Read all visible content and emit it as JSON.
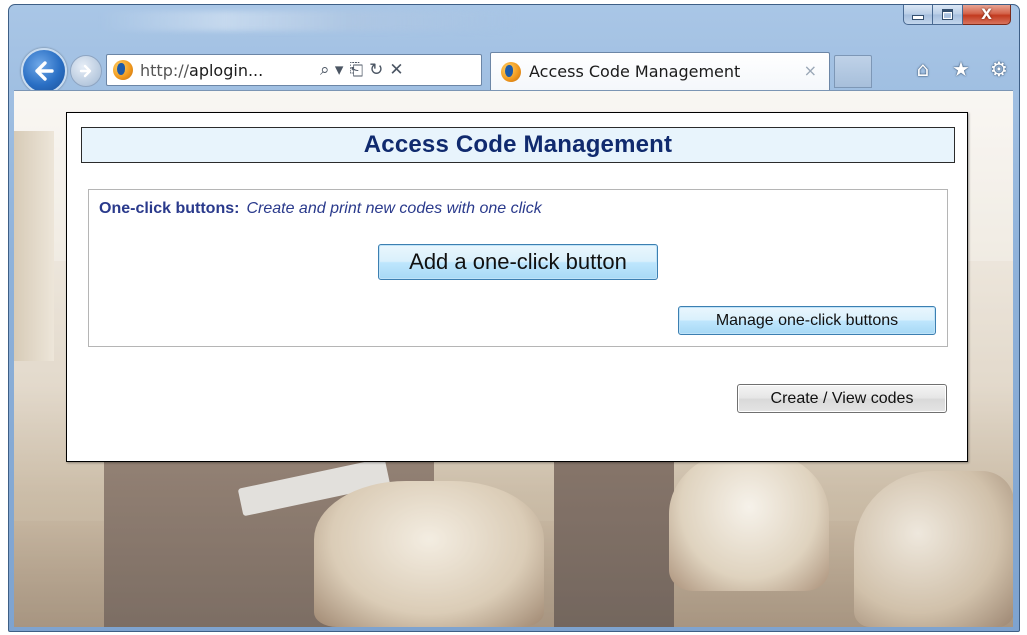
{
  "browser": {
    "address": {
      "scheme": "http://",
      "host": "aplogin...",
      "tools": [
        "⌕ ▾",
        "⎗",
        "↻",
        "✕"
      ]
    },
    "tab": {
      "title": "Access Code Management",
      "close": "×"
    },
    "caption": {
      "close": "X"
    }
  },
  "page": {
    "title": "Access Code Management",
    "one_click": {
      "label": "One-click buttons:",
      "description": "Create and print new codes with one click",
      "add_button": "Add a one-click button",
      "manage_button": "Manage one-click buttons"
    },
    "create_view_button": "Create / View codes"
  },
  "colors": {
    "title_text": "#102a6e",
    "title_bar_bg": "#e8f4fc",
    "label_text": "#2a3a8c"
  },
  "icons": {
    "back": "back-arrow-icon",
    "forward": "forward-arrow-icon",
    "home": "home-icon",
    "favorites": "star-icon",
    "tools": "gear-icon"
  }
}
